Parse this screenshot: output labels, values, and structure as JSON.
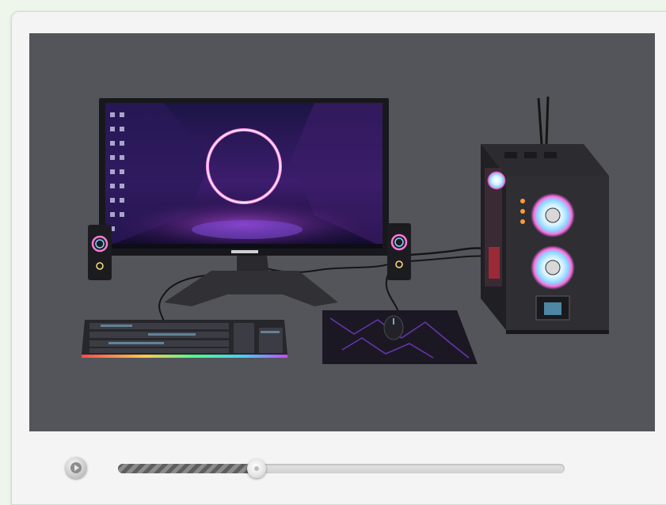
{
  "player": {
    "scene": "gaming-pc-setup",
    "progress_fraction": 0.31,
    "colors": {
      "viewport_background": "#54555b",
      "track": "#d6d6d6",
      "fill": "#6e6e6e",
      "rgb_accent_pink": "#ff4fd8",
      "rgb_accent_cyan": "#5fd3ff"
    },
    "icons": {
      "play": "play-icon",
      "seek_thumb": "slider-thumb-icon"
    }
  }
}
